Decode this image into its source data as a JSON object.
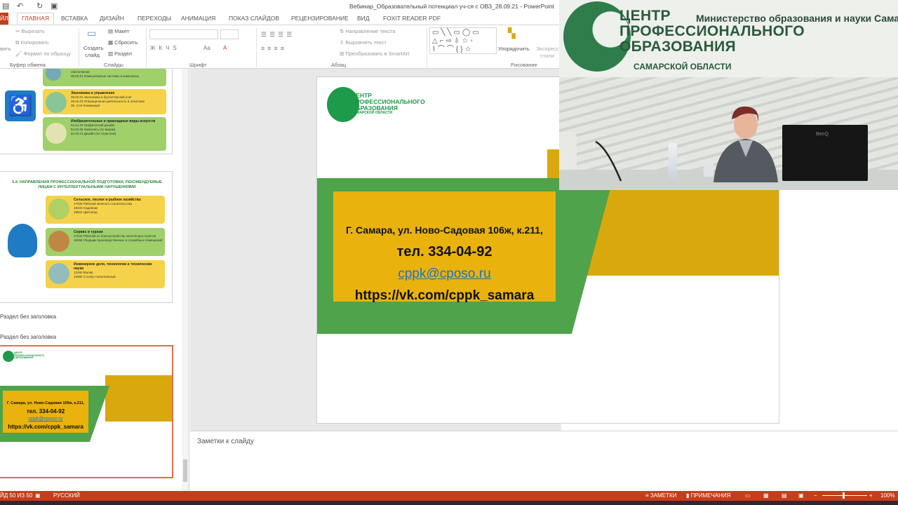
{
  "window": {
    "title": "Вебинар_Образовательный потенциал уч-ся с ОВЗ_28.09.21 - PowerPoint"
  },
  "ribbon_tabs": {
    "file": "ЙЛ",
    "home": "ГЛАВНАЯ",
    "insert": "ВСТАВКА",
    "design": "ДИЗАЙН",
    "transitions": "ПЕРЕХОДЫ",
    "animation": "АНИМАЦИЯ",
    "slideshow": "ПОКАЗ СЛАЙДОВ",
    "review": "РЕЦЕНЗИРОВАНИЕ",
    "view": "ВИД",
    "foxit": "FOXIT READER PDF"
  },
  "ribbon": {
    "paste": "вить",
    "cut": "Вырезать",
    "copy": "Копировать",
    "format_painter": "Формат по образцу",
    "new_slide_1": "Создать",
    "new_slide_2": "слайд",
    "layout": "Макет",
    "reset": "Сбросить",
    "section": "Раздел",
    "text_direction": "Направление текста",
    "align_text": "Выровнять текст",
    "smartart": "Преобразовать в SmartArt",
    "arrange": "Упорядочить",
    "quick_styles_1": "Экспресс-",
    "quick_styles_2": "стили",
    "group_clipboard": "Буфер обмена",
    "group_slides": "Слайды",
    "group_font": "Шрифт",
    "group_paragraph": "Абзац",
    "group_drawing": "Рисование"
  },
  "thumbnails": {
    "slide_a_cards": [
      {
        "title": "",
        "lines": [
          "обеспечение",
          "09.02.01 Компьютерные системы и комплексы"
        ]
      },
      {
        "title": "Экономика и управление",
        "lines": [
          "38.02.01 Экономика и бухгалтерский учет",
          "38.02.03 Операционная деятельность в логистике",
          "38. 2.04 Коммерция"
        ]
      },
      {
        "title": "Изобразительные и прикладные виды искусств",
        "lines": [
          "54.01.20 Графический дизайн",
          "54.02.05 Живопись (по видам)",
          "54.02.01 Дизайн (по отраслям)"
        ]
      }
    ],
    "slide_b_title": "5.9. НАПРАВЛЕНИЯ ПРОФЕССИОНАЛЬНОЙ ПОДГОТОВКИ, РЕКОМЕНДУЕМЫЕ ЛИЦАМ С ИНТЕЛЛЕКТУАЛЬНЫМИ НАРУШЕНИЯМИ",
    "slide_b_cards": [
      {
        "title": "Сельское, лесное и рыбное хозяйство",
        "lines": [
          "17530 Рабочий зеленого строительства",
          "18103 Садовник",
          "18524 Цветовод"
        ]
      },
      {
        "title": "Сервис и туризм",
        "lines": [
          "17543 Рабочий по благоустройству населенных пунктов",
          "19258 Уборщик производственных и служебных помещений"
        ]
      },
      {
        "title": "Инженерное дело, технологии и технические науки",
        "lines": [
          "12480 Маляр",
          "16680 Столяр строительный"
        ]
      }
    ],
    "section_1": "Раздел без заголовка",
    "section_2": "Раздел без заголовка"
  },
  "slide": {
    "logo_line1": "ЦЕНТР",
    "logo_line2": "ПРОФЕССИОНАЛЬНОГО",
    "logo_line3": "ОБРАЗОВАНИЯ",
    "logo_line4": "САМАРСКОЙ ОБЛАСТИ",
    "address": "Г. Самара, ул. Ново-Садовая 106ж, к.211,",
    "phone": "тел. 334-04-92",
    "email": "cppk@cposo.ru",
    "vk": "https://vk.com/cppk_samara"
  },
  "notes": {
    "placeholder": "Заметки к слайду"
  },
  "video": {
    "logo_line1": "ЦЕНТР",
    "logo_line2": "ПРОФЕССИОНАЛЬНОГО",
    "logo_line3": "ОБРАЗОВАНИЯ",
    "logo_line4": "САМАРСКОЙ ОБЛАСТИ",
    "ministry": "Министерство образования и науки Самарской",
    "monitor_brand": "BenQ"
  },
  "statusbar": {
    "slide_counter": "ЙД 50 ИЗ 50",
    "language": "РУССКИЙ",
    "notes": "ЗАМЕТКИ",
    "comments": "ПРИМЕЧАНИЯ",
    "zoom": "100%"
  },
  "colors": {
    "accent": "#c43e1c",
    "slide_green": "#4fa34a",
    "slide_yellow": "#d9a80c",
    "logo_green": "#1d9a4a"
  }
}
